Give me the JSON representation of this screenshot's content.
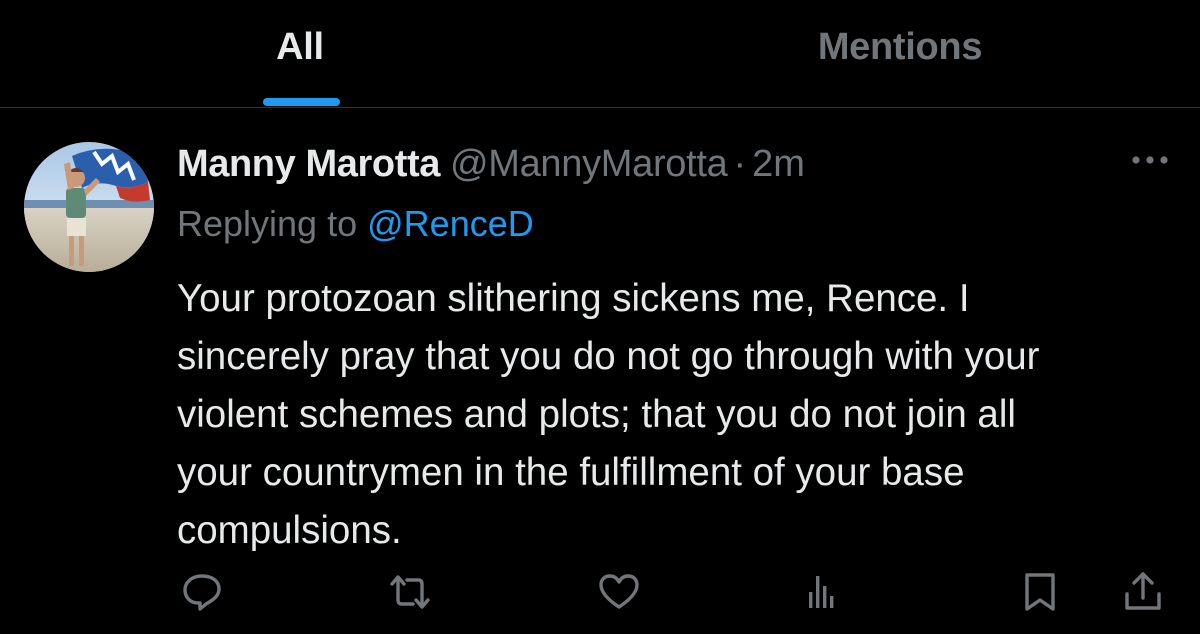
{
  "tabs": [
    {
      "label": "All",
      "active": true
    },
    {
      "label": "Mentions",
      "active": false
    }
  ],
  "tweet": {
    "author": {
      "display_name": "Manny Marotta",
      "handle": "@MannyMarotta",
      "avatar_icon": "avatar-photo"
    },
    "separator": "·",
    "time": "2m",
    "replying_to_prefix": "Replying to",
    "replying_to_handle": "@RenceD",
    "text_lines": [
      "Your protozoan slithering sickens me, Rence. I",
      "sincerely pray that you do not go through with your",
      "violent schemes and plots; that you do not join all",
      "your countrymen in the fulfillment of your base",
      "compulsions."
    ],
    "actions": [
      {
        "name": "reply",
        "icon": "reply-icon"
      },
      {
        "name": "retweet",
        "icon": "retweet-icon"
      },
      {
        "name": "like",
        "icon": "heart-icon"
      },
      {
        "name": "views",
        "icon": "views-icon"
      },
      {
        "name": "bookmark",
        "icon": "bookmark-icon"
      },
      {
        "name": "share",
        "icon": "share-icon"
      }
    ]
  },
  "colors": {
    "background": "#000000",
    "text_primary": "#e7e9ea",
    "text_secondary": "#71767b",
    "accent": "#1d9bf0",
    "divider": "#2f3336"
  }
}
